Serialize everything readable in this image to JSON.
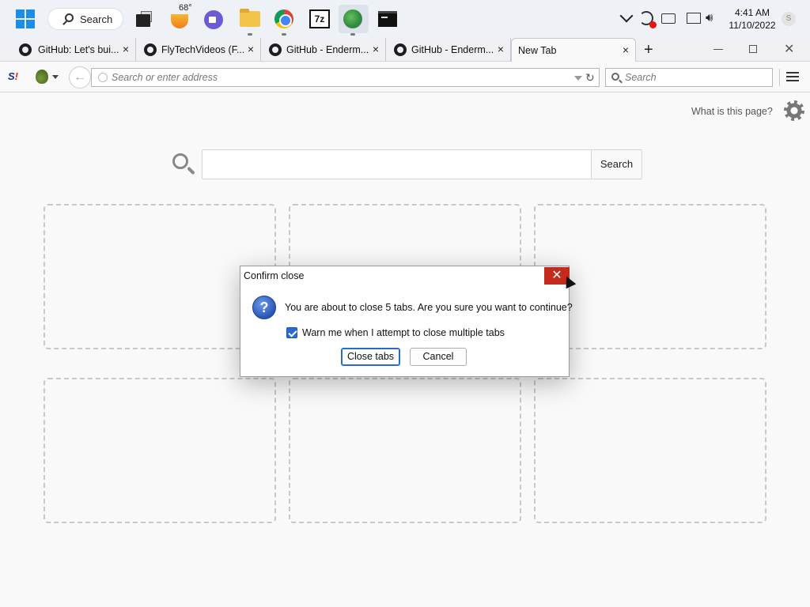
{
  "taskbar": {
    "search_label": "Search",
    "weather_temp": "68°",
    "icons": [
      "windows-start-icon",
      "task-view-icon",
      "weather-icon",
      "meet-icon",
      "file-explorer-icon",
      "chrome-icon",
      "7zip-icon",
      "globe-browser-icon",
      "terminal-icon"
    ],
    "app_7zip_text": "7z",
    "clock_time": "4:41 AM",
    "clock_date": "11/10/2022",
    "user_initial": "S"
  },
  "tabs": [
    {
      "title": "GitHub: Let's bui...",
      "close": "×"
    },
    {
      "title": "FlyTechVideos (F...",
      "close": "×"
    },
    {
      "title": "GitHub - Enderm...",
      "close": "×"
    },
    {
      "title": "GitHub - Enderm...",
      "close": "×"
    },
    {
      "title": "New Tab",
      "close": "×",
      "active": true
    }
  ],
  "window_controls": {
    "new_tab": "+",
    "close": "✕"
  },
  "navbar": {
    "ext_s_a": "S",
    "ext_s_b": "!",
    "back": "←",
    "url_placeholder": "Search or enter address",
    "reload": "↻",
    "search_placeholder": "Search"
  },
  "page": {
    "what_link": "What is this page?",
    "search_button": "Search",
    "tiles_count": 6
  },
  "dialog": {
    "title": "Confirm close",
    "close": "✕",
    "question_glyph": "?",
    "message": "You are about to close 5 tabs. Are you sure you want to continue?",
    "checkbox_label": "Warn me when I attempt to close multiple tabs",
    "checkbox_checked": true,
    "primary_button": "Close tabs",
    "cancel_button": "Cancel"
  },
  "colors": {
    "dialog_close_bg": "#c42b1c",
    "checkbox_blue": "#2a6ad1",
    "windows_blue": "#1a8ee8"
  }
}
